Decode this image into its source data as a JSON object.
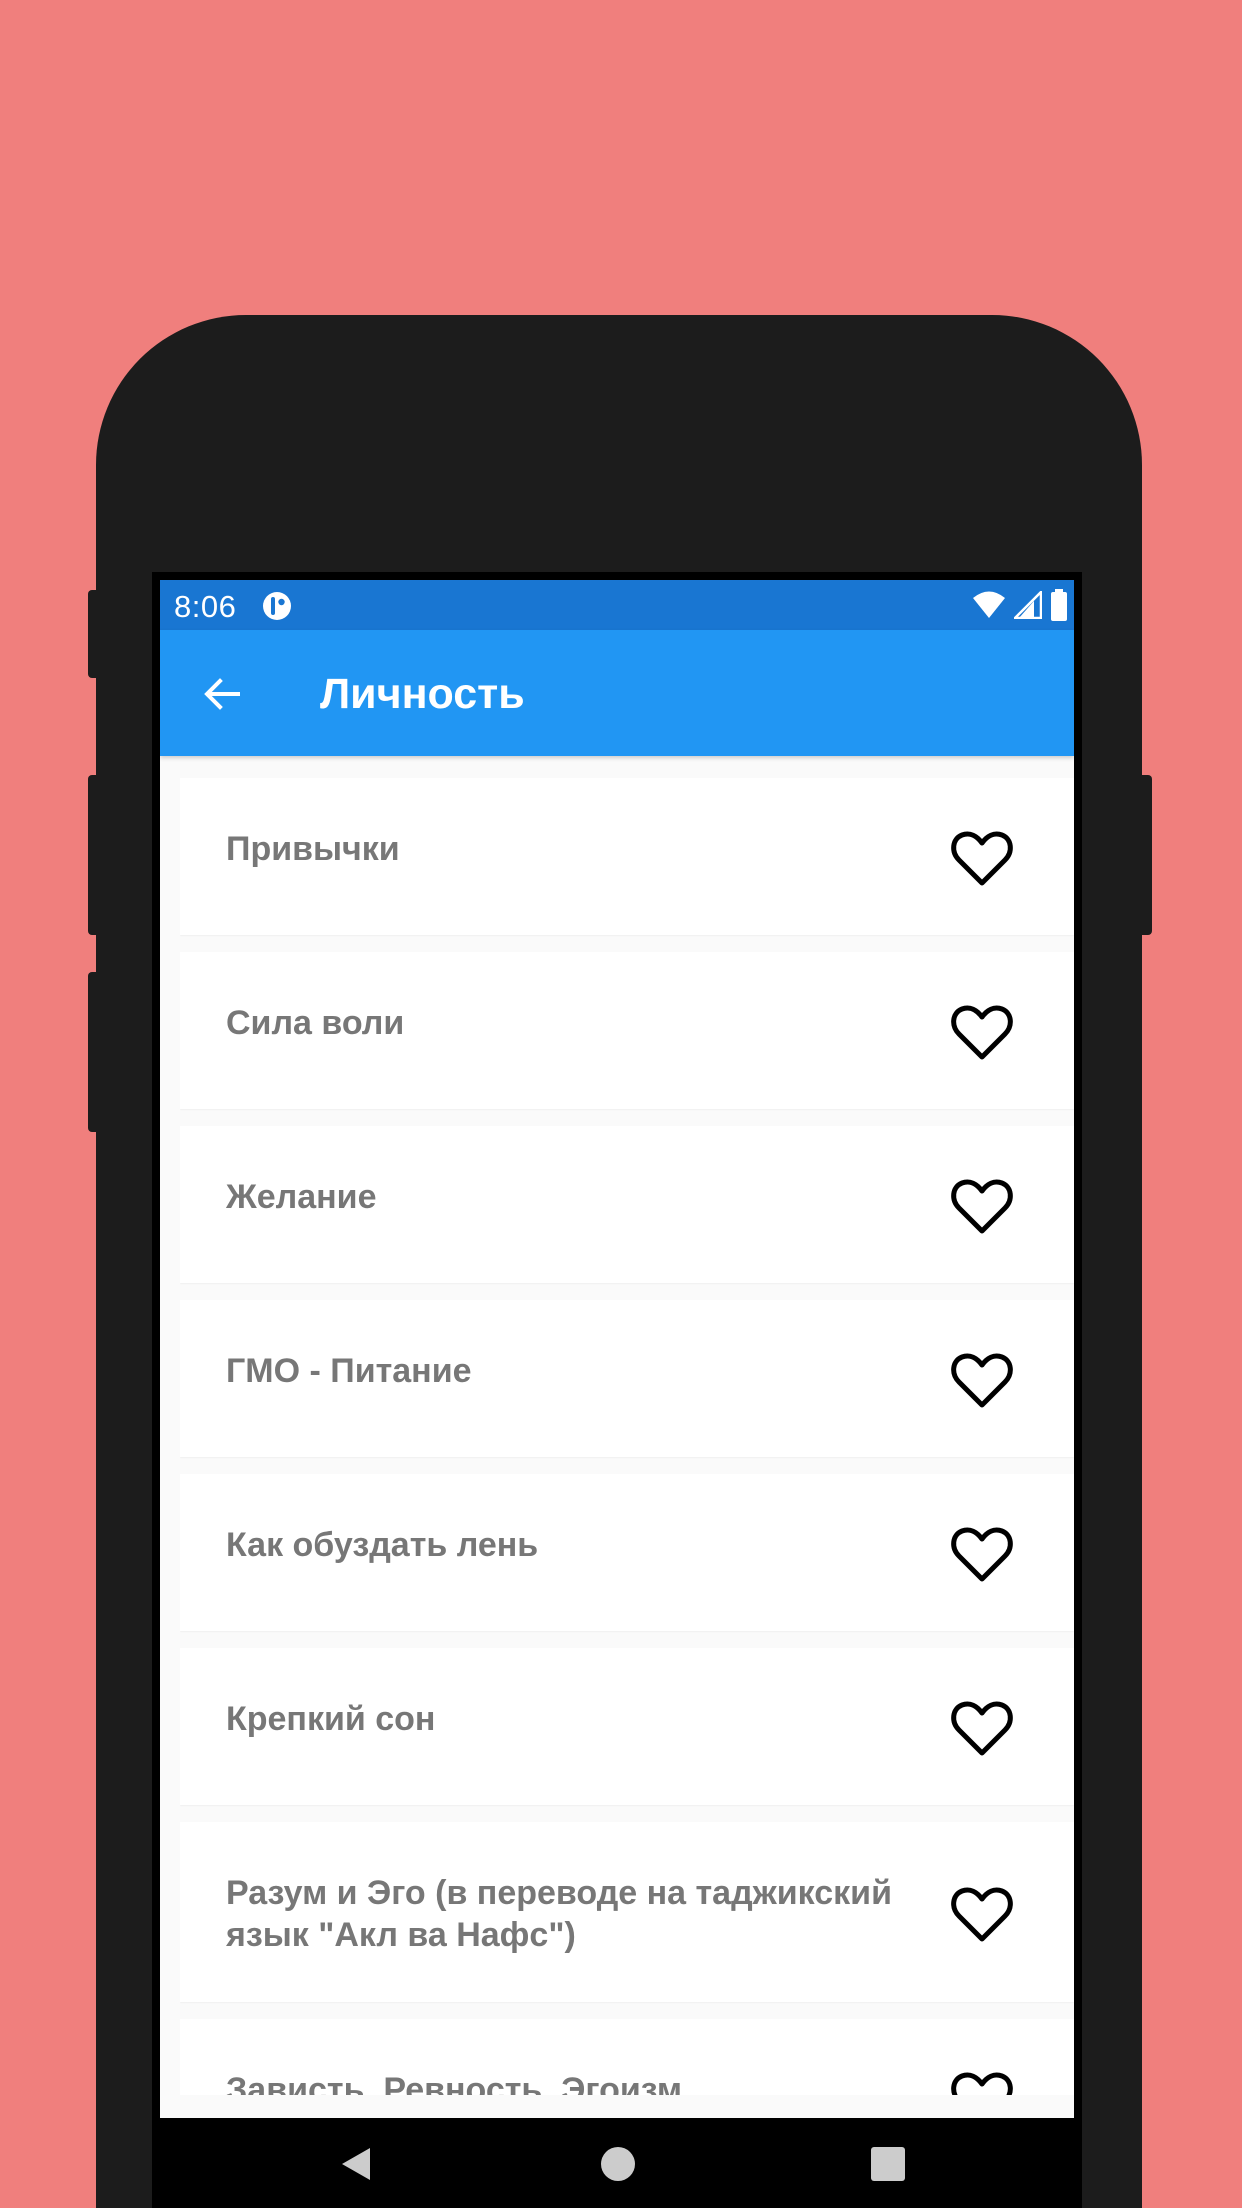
{
  "status_bar": {
    "time": "8:06",
    "app_icon": "app-notification-icon",
    "icons": [
      "wifi-icon",
      "cell-signal-icon",
      "battery-icon"
    ]
  },
  "app_bar": {
    "back_icon": "arrow-left-icon",
    "title": "Личность"
  },
  "list": {
    "items": [
      {
        "label": "Привычки",
        "favorite": false
      },
      {
        "label": "Сила воли",
        "favorite": false
      },
      {
        "label": "Желание",
        "favorite": false
      },
      {
        "label": "ГМО - Питание",
        "favorite": false
      },
      {
        "label": "Как обуздать лень",
        "favorite": false
      },
      {
        "label": "Крепкий сон",
        "favorite": false
      },
      {
        "label": "Разум и Эго (в переводе на таджикский язык \"Акл ва Нафс\")",
        "favorite": false
      },
      {
        "label": "Зависть, Ревность, Эгоизм",
        "favorite": false
      }
    ],
    "favorite_icon": "heart-outline-icon"
  },
  "nav_bar": {
    "buttons": [
      "back-triangle-icon",
      "home-circle-icon",
      "recents-square-icon"
    ]
  },
  "colors": {
    "background": "#f07f7d",
    "status_bar": "#1976d2",
    "app_bar": "#2196f3",
    "item_text": "#777777"
  }
}
